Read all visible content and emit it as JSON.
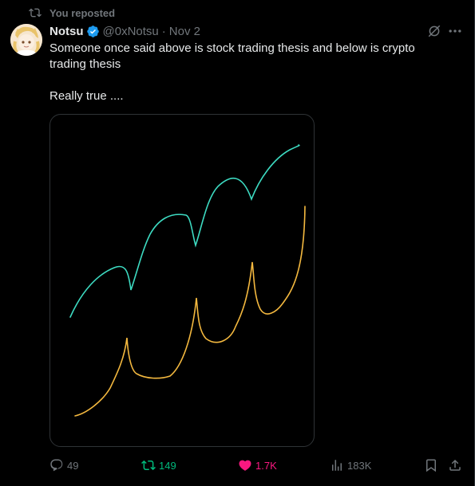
{
  "repost": {
    "label": "You reposted"
  },
  "author": {
    "name": "Notsu",
    "handle": "@0xNotsu",
    "separator": "·",
    "date": "Nov 2"
  },
  "tweet": {
    "line1": "Someone once said above is stock trading thesis and below is crypto trading thesis",
    "line2": "Really true ...."
  },
  "media": {
    "upper_curve_color": "#3ddbc2",
    "lower_curve_color": "#f3b83f"
  },
  "actions": {
    "replies": "49",
    "reposts": "149",
    "likes": "1.7K",
    "views": "183K"
  },
  "colors": {
    "accent_repost": "#00ba7c",
    "accent_like": "#f91880",
    "verified": "#1d9bf0",
    "muted": "#71767b"
  }
}
